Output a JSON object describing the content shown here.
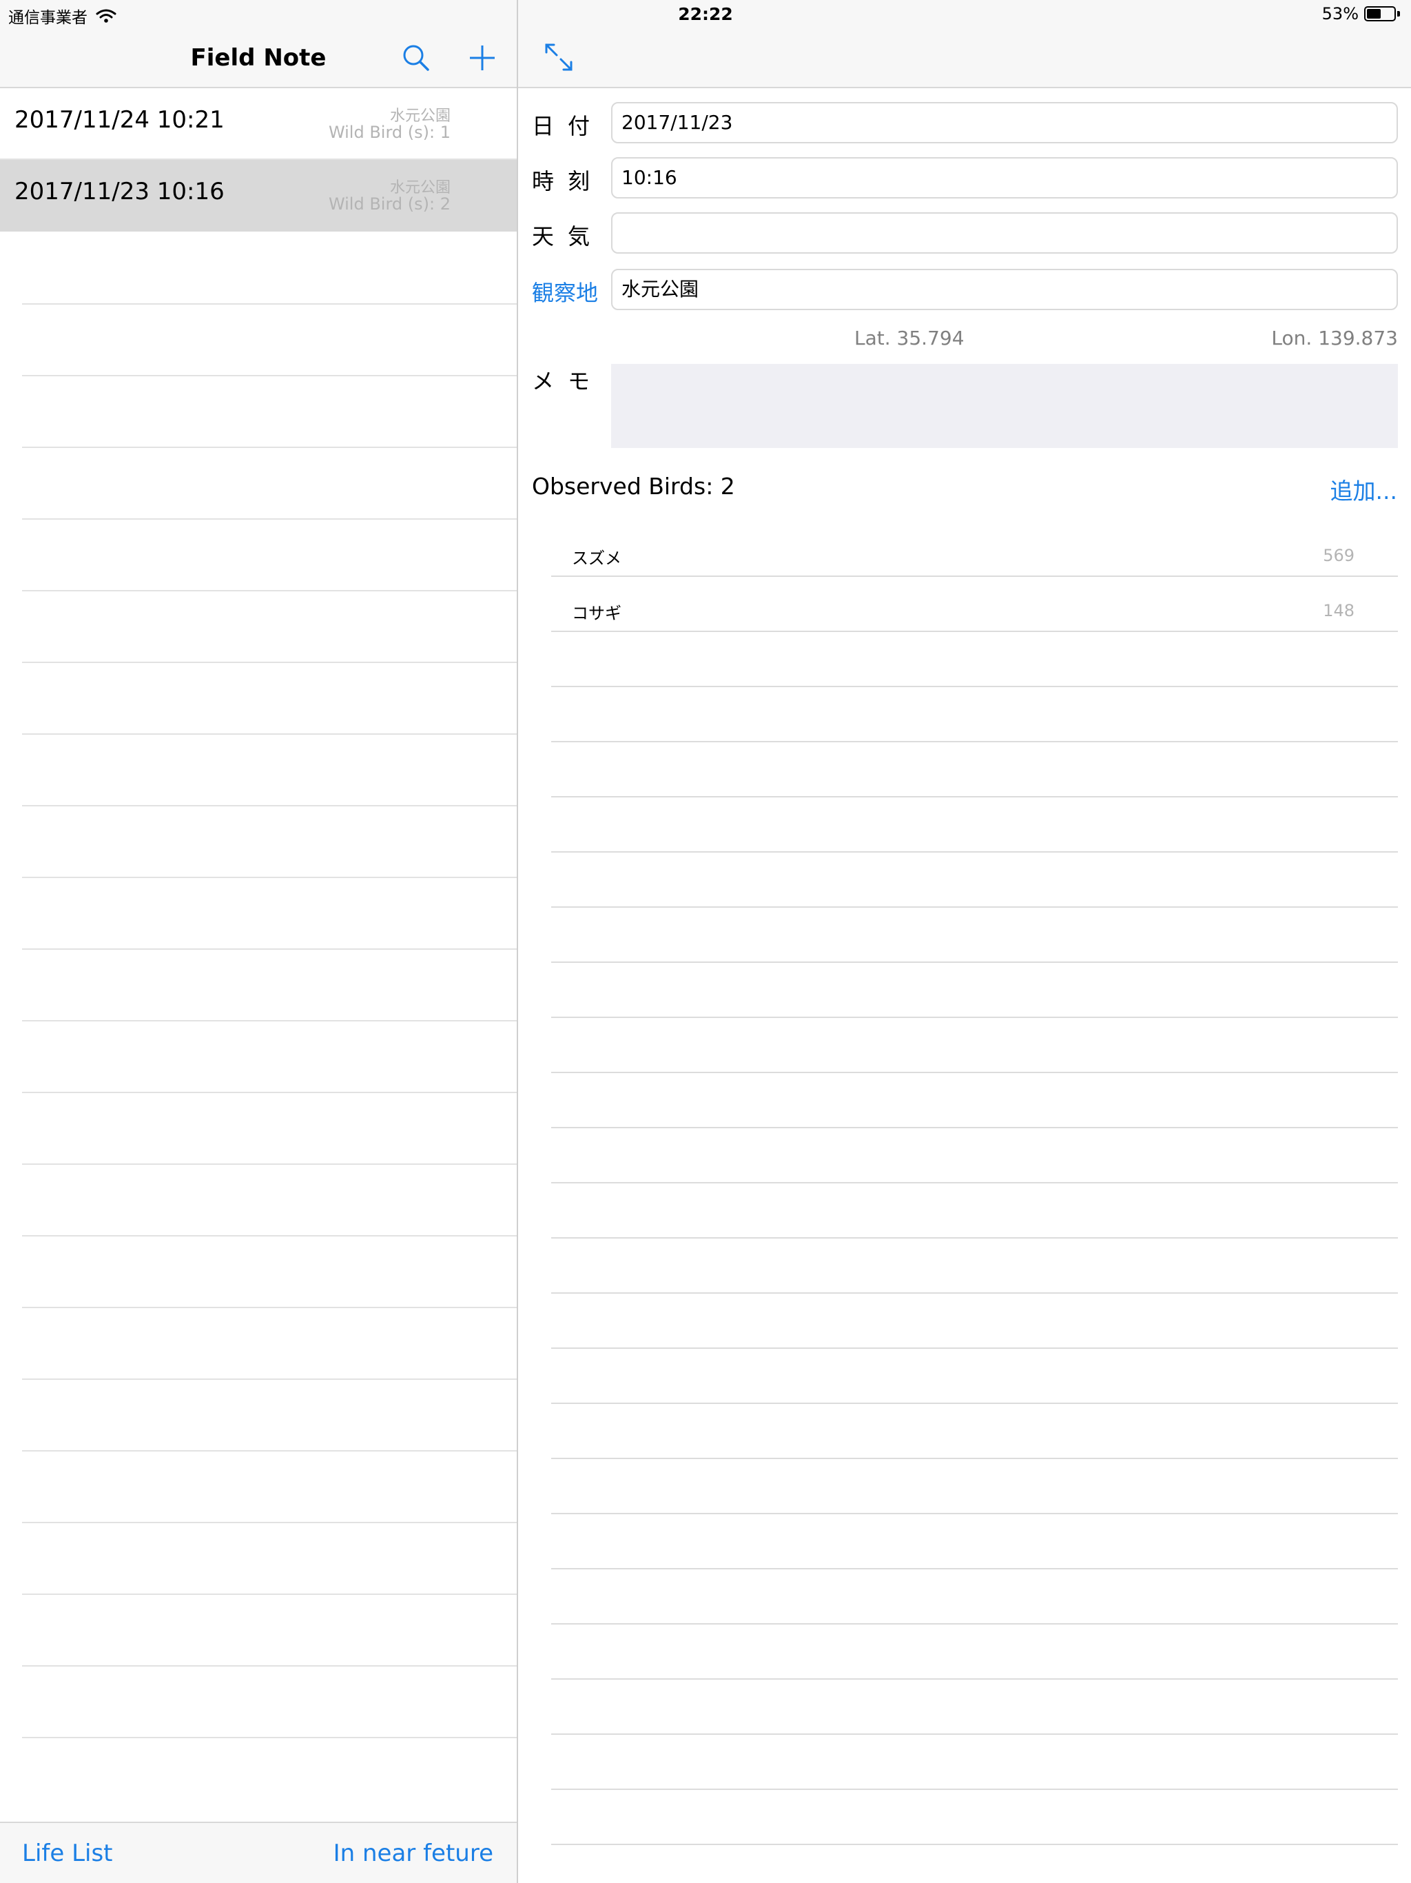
{
  "status_bar": {
    "carrier": "通信事業者",
    "time": "22:22",
    "battery": "53%",
    "battery_level": 0.53
  },
  "master": {
    "title": "Field Note",
    "entries": [
      {
        "date": "2017/11/24 10:21",
        "place": "水元公園",
        "count": "Wild Bird (s): 1",
        "selected": false
      },
      {
        "date": "2017/11/23 10:16",
        "place": "水元公園",
        "count": "Wild Bird (s): 2",
        "selected": true
      }
    ],
    "toolbar": {
      "left": "Life List",
      "right": "In near feture"
    }
  },
  "detail": {
    "fields": {
      "date_label": "日付",
      "date_value": "2017/11/23",
      "time_label": "時刻",
      "time_value": "10:16",
      "weather_label": "天気",
      "weather_value": "",
      "location_label": "観察地",
      "location_value": "水元公園",
      "memo_label": "メモ"
    },
    "lat": "Lat. 35.794",
    "lon": "Lon. 139.873",
    "observed_title": "Observed Birds: 2",
    "add_button": "追加...",
    "birds": [
      {
        "name": "スズメ",
        "number": "569"
      },
      {
        "name": "コサギ",
        "number": "148"
      }
    ]
  },
  "colors": {
    "accent": "#1b7fe5",
    "selected_row": "#d9d9d9",
    "bar_background": "#f7f7f7",
    "memo_background": "#efeff4"
  },
  "icons": {
    "search": "search-icon",
    "add": "plus-icon",
    "expand": "expand-icon",
    "wifi": "wifi-icon",
    "battery": "battery-icon"
  }
}
